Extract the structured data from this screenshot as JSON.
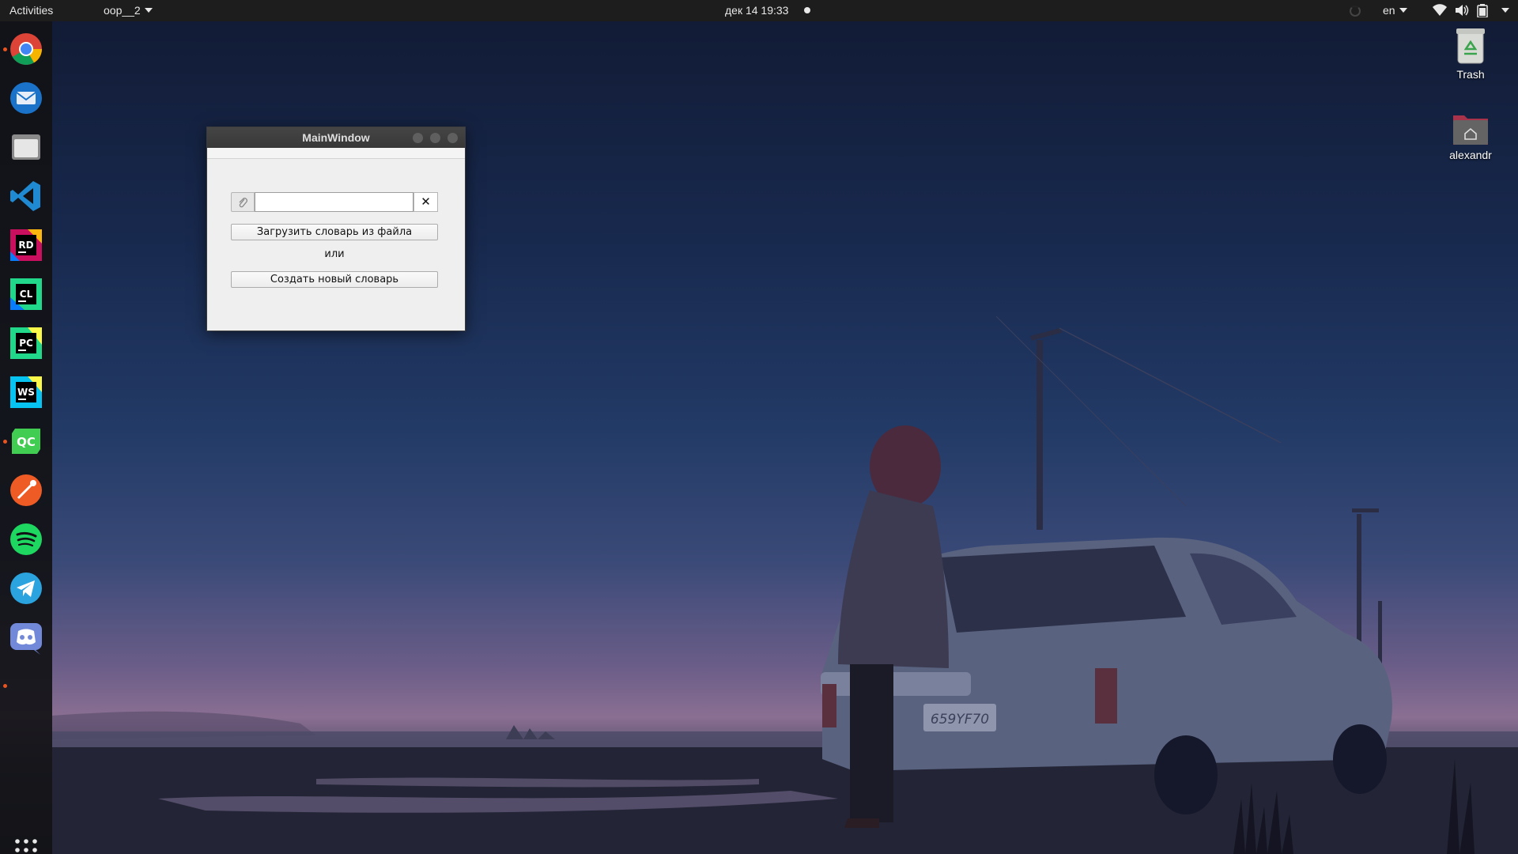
{
  "topbar": {
    "activities": "Activities",
    "app_menu": "oop__2",
    "clock": "дек 14  19:33",
    "language": "en"
  },
  "dock": {
    "items": [
      {
        "icon": "chrome-icon",
        "running": true
      },
      {
        "icon": "thunderbird-icon",
        "running": false
      },
      {
        "icon": "files-icon",
        "running": false
      },
      {
        "icon": "vscode-icon",
        "running": false
      },
      {
        "icon": "rider-icon",
        "running": false
      },
      {
        "icon": "clion-icon",
        "running": false
      },
      {
        "icon": "pycharm-icon",
        "running": false
      },
      {
        "icon": "webstorm-icon",
        "running": false
      },
      {
        "icon": "qtcreator-icon",
        "running": true
      },
      {
        "icon": "postman-icon",
        "running": false
      },
      {
        "icon": "spotify-icon",
        "running": false
      },
      {
        "icon": "telegram-icon",
        "running": false
      },
      {
        "icon": "discord-icon",
        "running": false
      }
    ],
    "show_apps_icon": "grid-icon"
  },
  "desktop": {
    "trash_label": "Trash",
    "home_label": "alexandr"
  },
  "window": {
    "title": "MainWindow",
    "file_path_value": "",
    "clear_label": "✕",
    "load_button": "Загрузить словарь из файла",
    "or_label": "или",
    "create_button": "Создать новый словарь"
  },
  "wallpaper": {
    "license_plate": "659YF70"
  },
  "colors": {
    "accent": "#e95420",
    "topbar_bg": "#1d1d1d",
    "dock_bg": "#121216",
    "window_bg": "#efefef",
    "titlebar_bg": "#3c3c3c"
  }
}
